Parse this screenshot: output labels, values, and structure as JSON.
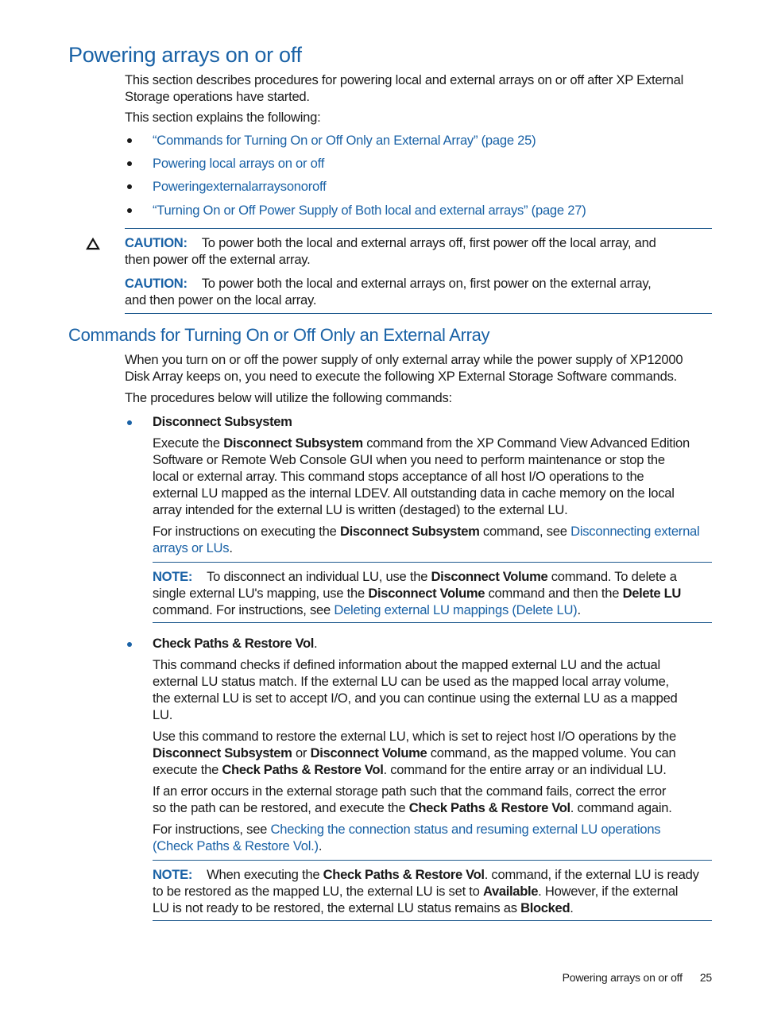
{
  "heading": "Powering arrays on or off",
  "intro": {
    "para1": "This section describes procedures for powering local and external arrays on or off after XP External Storage operations have started.",
    "para1_line1": "This section describes procedures for powering local and external arrays on or off after XP External",
    "para1_line2": "Storage operations have started.",
    "para2": "This section explains the following:"
  },
  "toc_links": [
    "“Commands for Turning On or Off Only an External Array” (page 25)",
    "Powering local arrays on or off",
    "Poweringexternalarraysonoroff",
    "“Turning On or Off Power Supply of Both local and external arrays” (page 27)"
  ],
  "cautions": {
    "icon": "warning-triangle-icon",
    "label": "CAUTION:",
    "items": [
      {
        "line1": "To power both the local and external arrays off, first power off the local array, and",
        "line2": "then power off the external array."
      },
      {
        "line1": "To power both the local and external arrays on, first power on the external array,",
        "line2": "and then power on the local array."
      }
    ]
  },
  "section": {
    "heading": "Commands for Turning On or Off Only an External Array",
    "para1_line1": "When you turn on or off the power supply of only external array while the power supply of XP12000",
    "para1_line2": "Disk Array keeps on, you need to execute the following XP External Storage Software commands.",
    "para2": "The procedures below will utilize the following commands:",
    "commands": [
      {
        "title": "Disconnect Subsystem",
        "desc": {
          "l1_a": "Execute the ",
          "l1_b": "Disconnect Subsystem",
          "l1_c": " command from the XP Command View Advanced Edition",
          "l2": "Software or Remote Web Console GUI when you need to perform maintenance or stop the",
          "l3": "local or external array. This command stops acceptance of all host I/O operations to the",
          "l4": "external LU mapped as the internal LDEV. All outstanding data in cache memory on the local",
          "l5": "array intended for the external LU is written (destaged) to the external LU."
        },
        "instr": {
          "a": "For instructions on executing the ",
          "b": "Disconnect Subsystem",
          "c": " command, see ",
          "link_l1": "Disconnecting external",
          "link_l2": "arrays or LUs",
          "end": "."
        },
        "note": {
          "label": "NOTE:",
          "l1_a": "To disconnect an individual LU, use the ",
          "l1_b": "Disconnect Volume",
          "l1_c": " command. To delete a",
          "l2_a": "single external LU's mapping, use the ",
          "l2_b": "Disconnect Volume",
          "l2_c": " command and then the ",
          "l2_d": "Delete LU",
          "l3_a": "command. For instructions, see ",
          "l3_link": "Deleting external LU mappings (Delete LU)",
          "l3_end": "."
        }
      },
      {
        "title": "Check Paths & Restore Vol",
        "title_suffix": ".",
        "desc": {
          "l1": "This command checks if defined information about the mapped external LU and the actual",
          "l2": "external LU status match. If the external LU can be used as the mapped local array volume,",
          "l3": "the external LU is set to accept I/O, and you can continue using the external LU as a mapped",
          "l4": "LU."
        },
        "use": {
          "l1": "Use this command to restore the external LU, which is set to reject host I/O operations by the",
          "l2_a": "Disconnect Subsystem",
          "l2_b": " or ",
          "l2_c": "Disconnect Volume",
          "l2_d": " command, as the mapped volume. You can",
          "l3_a": "execute the ",
          "l3_b": "Check Paths & Restore Vol",
          "l3_c": ". command for the entire array or an individual LU."
        },
        "error": {
          "l1": "If an error occurs in the external storage path such that the command fails, correct the error",
          "l2_a": "so the path can be restored, and execute the ",
          "l2_b": "Check Paths & Restore Vol",
          "l2_c": ". command again."
        },
        "instr": {
          "a": "For instructions, see ",
          "link_l1": "Checking the connection status and resuming external LU operations",
          "link_l2": "(Check Paths & Restore Vol.)",
          "end": "."
        },
        "note": {
          "label": "NOTE:",
          "l1_a": "When executing the ",
          "l1_b": "Check Paths & Restore Vol",
          "l1_c": ". command, if the external LU is ready",
          "l2_a": "to be restored as the mapped LU, the external LU is set to ",
          "l2_b": "Available",
          "l2_c": ". However, if the external",
          "l3_a": "LU is not ready to be restored, the external LU status remains as ",
          "l3_b": "Blocked",
          "l3_c": "."
        }
      }
    ]
  },
  "footer": {
    "title": "Powering arrays on or off",
    "page_number": "25"
  }
}
